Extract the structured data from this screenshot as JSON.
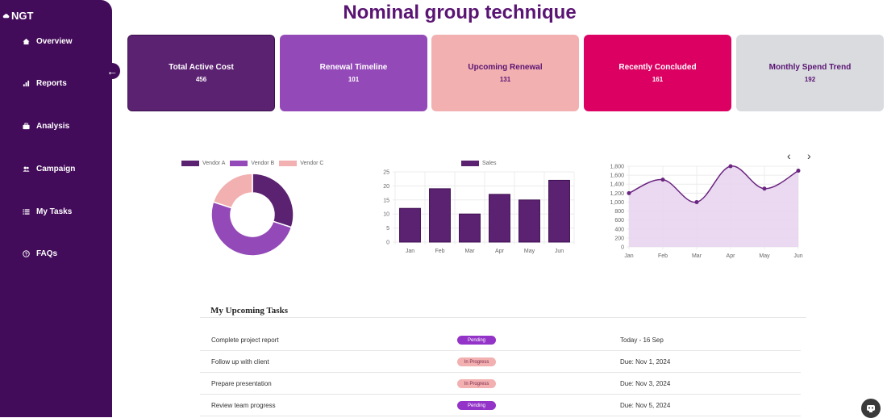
{
  "app": {
    "logo_text": "NGT",
    "page_title": "Nominal group technique"
  },
  "sidebar": {
    "items": [
      {
        "label": "Overview",
        "icon": "home-icon"
      },
      {
        "label": "Reports",
        "icon": "bar-chart-icon"
      },
      {
        "label": "Analysis",
        "icon": "briefcase-icon"
      },
      {
        "label": "Campaign",
        "icon": "users-icon"
      },
      {
        "label": "My Tasks",
        "icon": "list-icon"
      },
      {
        "label": "FAQs",
        "icon": "question-icon"
      }
    ]
  },
  "cards": [
    {
      "title": "Total Active Cost",
      "value": "456",
      "bg": "#5c2272",
      "fg": "#ffffff"
    },
    {
      "title": "Renewal Timeline",
      "value": "101",
      "bg": "#9349b8",
      "fg": "#ffffff"
    },
    {
      "title": "Upcoming Renewal",
      "value": "131",
      "bg": "#f2b0b1",
      "fg": "#5a1473"
    },
    {
      "title": "Recently Concluded",
      "value": "161",
      "bg": "#dc0062",
      "fg": "#ffffff"
    },
    {
      "title": "Monthly Spend Trend",
      "value": "192",
      "bg": "#d9dbdf",
      "fg": "#5a1473"
    }
  ],
  "chart_data": [
    {
      "type": "pie",
      "variant": "doughnut",
      "legend_position": "top",
      "labels": [
        "Vendor A",
        "Vendor B",
        "Vendor C"
      ],
      "values": [
        30,
        50,
        20
      ],
      "colors": [
        "#5c2272",
        "#9349b8",
        "#f2b0b1"
      ]
    },
    {
      "type": "bar",
      "legend_position": "top",
      "categories": [
        "Jan",
        "Feb",
        "Mar",
        "Apr",
        "May",
        "Jun"
      ],
      "series": [
        {
          "name": "Sales",
          "values": [
            12,
            19,
            10,
            17,
            15,
            22
          ],
          "color": "#5c2272"
        }
      ],
      "ylim": [
        0,
        25
      ],
      "yticks": [
        0,
        5,
        10,
        15,
        20,
        25
      ],
      "grid": true
    },
    {
      "type": "area",
      "categories": [
        "Jan",
        "Feb",
        "Mar",
        "Apr",
        "May",
        "Jun"
      ],
      "values": [
        1200,
        1500,
        1000,
        1800,
        1300,
        1700
      ],
      "ylim": [
        0,
        1800
      ],
      "yticks": [
        "0",
        "200",
        "400",
        "600",
        "800",
        "1,000",
        "1,200",
        "1,400",
        "1,600",
        "1,800"
      ],
      "line_color": "#6b2580",
      "fill_color": "#e8d5ef",
      "grid": true
    }
  ],
  "carousel": {
    "prev_icon": "chevron-left-icon",
    "next_icon": "chevron-right-icon"
  },
  "tasks": {
    "title": "My Upcoming Tasks",
    "rows": [
      {
        "name": "Complete project report",
        "status": "Pending",
        "date": "Today - 16 Sep"
      },
      {
        "name": "Follow up with client",
        "status": "In Progress",
        "date": "Due: Nov 1, 2024"
      },
      {
        "name": "Prepare presentation",
        "status": "In Progress",
        "date": "Due: Nov 3, 2024"
      },
      {
        "name": "Review team progress",
        "status": "Pending",
        "date": "Due: Nov 5, 2024"
      }
    ],
    "status_colors": {
      "Pending": "#9333c8",
      "In Progress": "#f2b0b1"
    }
  }
}
